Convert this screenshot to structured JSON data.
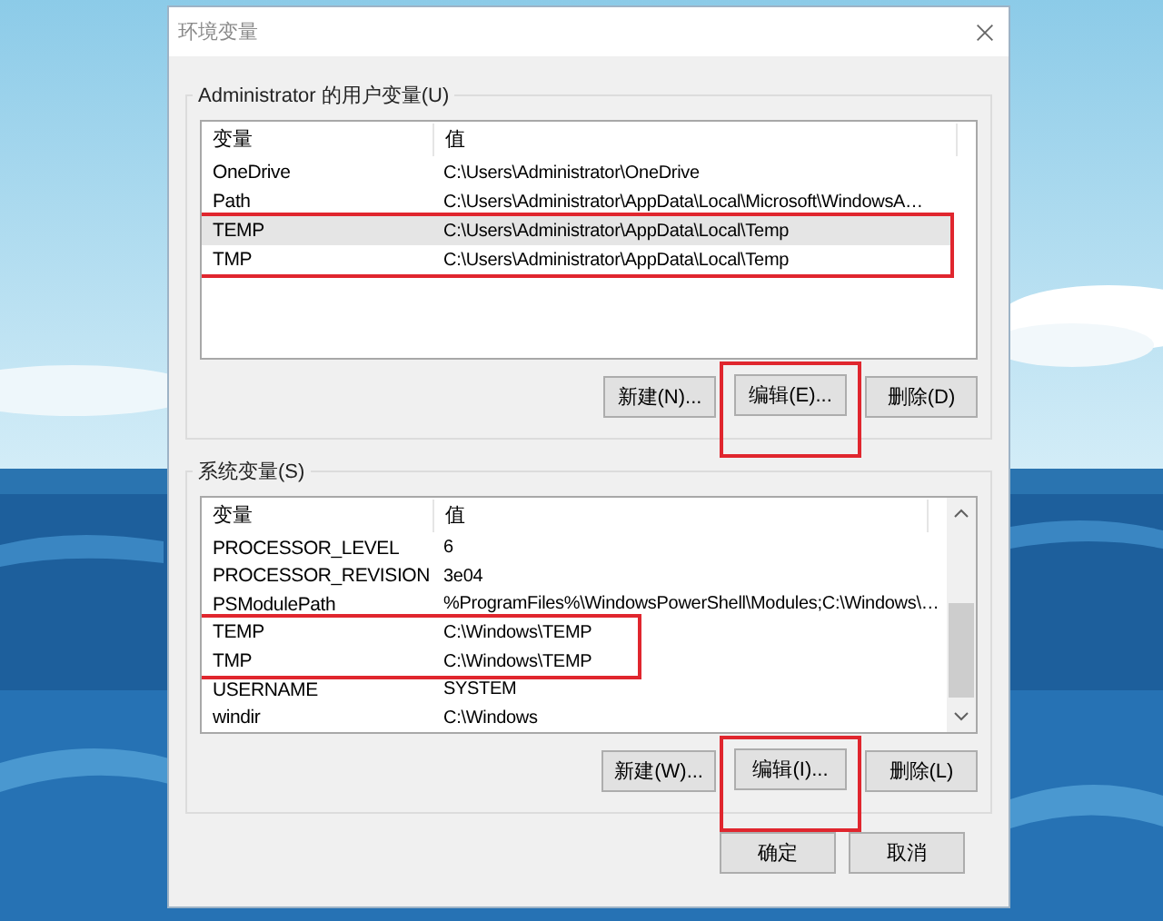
{
  "window": {
    "title": "环境变量"
  },
  "user_variables": {
    "label": "Administrator 的用户变量(U)",
    "columns": [
      "变量",
      "值"
    ],
    "scrollbar": false,
    "rows": [
      {
        "name": "OneDrive",
        "value": "C:\\Users\\Administrator\\OneDrive",
        "selected": false,
        "marked": false
      },
      {
        "name": "Path",
        "value": "C:\\Users\\Administrator\\AppData\\Local\\Microsoft\\WindowsA…",
        "selected": false,
        "marked": false
      },
      {
        "name": "TEMP",
        "value": "C:\\Users\\Administrator\\AppData\\Local\\Temp",
        "selected": true,
        "marked": true
      },
      {
        "name": "TMP",
        "value": "C:\\Users\\Administrator\\AppData\\Local\\Temp",
        "selected": false,
        "marked": true
      }
    ],
    "buttons": [
      {
        "label": "新建(N)...",
        "marked": false
      },
      {
        "label": "编辑(E)...",
        "marked": true
      },
      {
        "label": "删除(D)",
        "marked": false
      }
    ]
  },
  "system_variables": {
    "label": "系统变量(S)",
    "columns": [
      "变量",
      "值"
    ],
    "scrollbar": true,
    "rows": [
      {
        "name": "PROCESSOR_LEVEL",
        "value": "6",
        "selected": false,
        "marked": false
      },
      {
        "name": "PROCESSOR_REVISION",
        "value": "3e04",
        "selected": false,
        "marked": false
      },
      {
        "name": "PSModulePath",
        "value": "%ProgramFiles%\\WindowsPowerShell\\Modules;C:\\Windows\\…",
        "selected": false,
        "marked": false
      },
      {
        "name": "TEMP",
        "value": "C:\\Windows\\TEMP",
        "selected": false,
        "marked": true
      },
      {
        "name": "TMP",
        "value": "C:\\Windows\\TEMP",
        "selected": false,
        "marked": true
      },
      {
        "name": "USERNAME",
        "value": "SYSTEM",
        "selected": false,
        "marked": false
      },
      {
        "name": "windir",
        "value": "C:\\Windows",
        "selected": false,
        "marked": false
      }
    ],
    "buttons": [
      {
        "label": "新建(W)...",
        "marked": false
      },
      {
        "label": "编辑(I)...",
        "marked": true
      },
      {
        "label": "删除(L)",
        "marked": false
      }
    ]
  },
  "buttons": [
    {
      "label": "确定"
    },
    {
      "label": "取消"
    }
  ]
}
